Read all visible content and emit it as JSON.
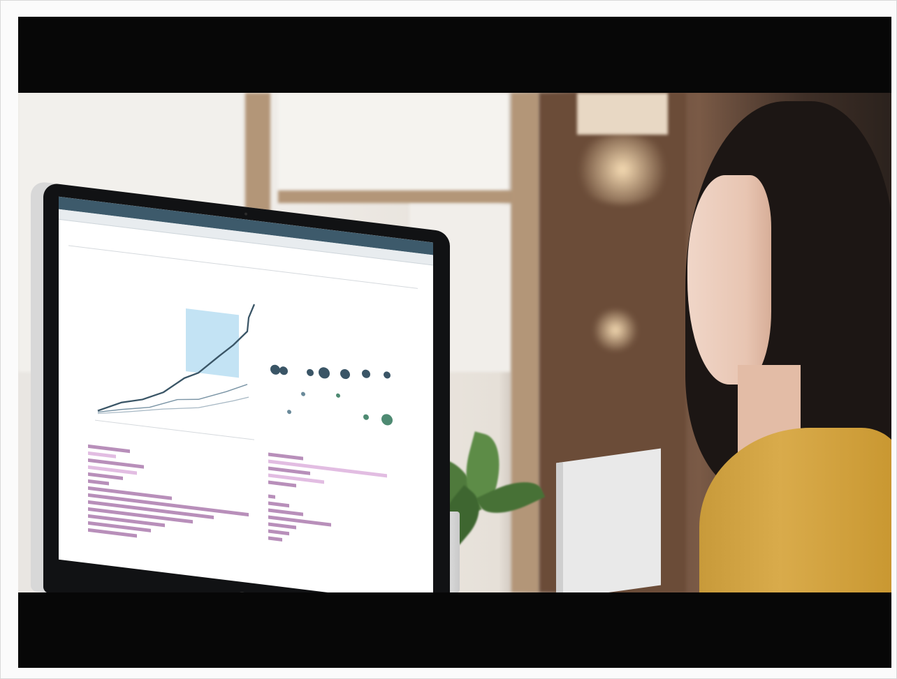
{
  "photo": {
    "description_labels": {},
    "monitor": {
      "dashboard_title": "",
      "selection_color": "#b9def2",
      "bar_color": "#b88fba",
      "line_color": "#3a5566"
    }
  },
  "colors": {
    "letterbox": "#070707",
    "sweater": "#d4a447",
    "hair": "#1c1614",
    "wood": "#6b4c38"
  }
}
